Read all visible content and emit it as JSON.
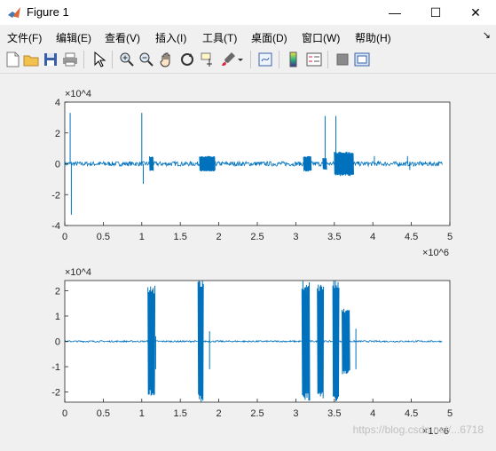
{
  "window": {
    "title": "Figure 1",
    "minimize": "—",
    "maximize": "☐",
    "close": "✕"
  },
  "menu": {
    "items": [
      "文件(F)",
      "编辑(E)",
      "查看(V)",
      "插入(I)",
      "工具(T)",
      "桌面(D)",
      "窗口(W)",
      "帮助(H)"
    ],
    "overflow": "↘"
  },
  "toolbar": {
    "icons": [
      "new-figure-icon",
      "open-file-icon",
      "save-icon",
      "print-icon",
      "pointer-icon",
      "zoom-in-icon",
      "zoom-out-icon",
      "pan-icon",
      "rotate-3d-icon",
      "data-cursor-icon",
      "brush-icon",
      "link-plot-icon",
      "colorbar-icon",
      "legend-icon",
      "hide-plot-tools-icon",
      "show-plot-tools-icon"
    ]
  },
  "colors": {
    "series": "#0072bd",
    "axes_bg": "#ffffff",
    "figure_bg": "#f0f0f0"
  },
  "watermark": "https://blog.csdn.net/...6718",
  "chart_data": [
    {
      "type": "line",
      "title": "",
      "xlabel": "",
      "ylabel": "",
      "xlim": [
        0,
        5
      ],
      "ylim": [
        -4,
        4
      ],
      "x_exponent": "×10^6",
      "y_exponent": "×10^4",
      "x_ticks": [
        "0",
        "0.5",
        "1",
        "1.5",
        "2",
        "2.5",
        "3",
        "3.5",
        "4",
        "4.5",
        "5"
      ],
      "y_ticks": [
        "4",
        "2",
        "0",
        "-2",
        "-4"
      ],
      "grid": false,
      "series": [
        {
          "baseline_noise": 0.15,
          "x_end": 4.9,
          "spikes": [
            [
              0.07,
              3.3
            ],
            [
              0.085,
              -3.3
            ],
            [
              1.0,
              3.3
            ],
            [
              1.02,
              -1.3
            ],
            [
              3.38,
              3.1
            ],
            [
              3.52,
              3.1
            ],
            [
              3.55,
              -0.6
            ],
            [
              4.02,
              0.5
            ],
            [
              4.45,
              0.5
            ],
            [
              4.48,
              -0.4
            ]
          ],
          "bursts": [
            [
              1.1,
              1.15,
              0.5
            ],
            [
              1.75,
              1.95,
              0.5
            ],
            [
              3.1,
              3.2,
              0.5
            ],
            [
              3.35,
              3.4,
              0.4
            ],
            [
              3.5,
              3.75,
              0.8
            ]
          ]
        }
      ]
    },
    {
      "type": "line",
      "title": "",
      "xlabel": "",
      "ylabel": "",
      "xlim": [
        0,
        5
      ],
      "ylim": [
        -2.4,
        2.4
      ],
      "x_exponent": "×10^6",
      "y_exponent": "×10^4",
      "x_ticks": [
        "0",
        "0.5",
        "1",
        "1.5",
        "2",
        "2.5",
        "3",
        "3.5",
        "4",
        "4.5",
        "5"
      ],
      "y_ticks": [
        "2",
        "1",
        "0",
        "-1",
        "-2"
      ],
      "grid": false,
      "series": [
        {
          "baseline_noise": 0.03,
          "x_end": 4.9,
          "spikes": [
            [
              1.18,
              0.2
            ],
            [
              1.18,
              -1.1
            ],
            [
              1.88,
              0.4
            ],
            [
              1.88,
              -1.1
            ],
            [
              3.78,
              0.5
            ],
            [
              3.78,
              -1.1
            ]
          ],
          "bursts": [
            [
              1.08,
              1.17,
              2.2
            ],
            [
              1.73,
              1.8,
              2.4
            ],
            [
              3.08,
              3.18,
              2.4
            ],
            [
              3.28,
              3.36,
              2.3
            ],
            [
              3.48,
              3.56,
              2.4
            ],
            [
              3.6,
              3.7,
              1.3
            ]
          ]
        }
      ]
    }
  ]
}
